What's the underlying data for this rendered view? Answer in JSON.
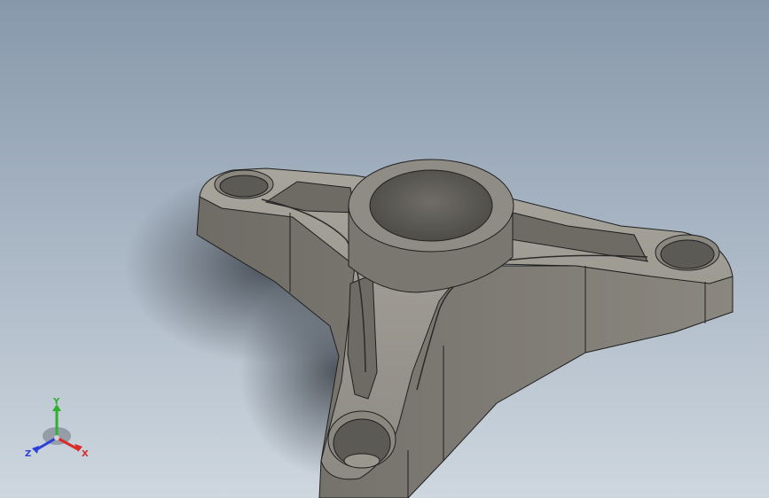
{
  "triad": {
    "x_label": "X",
    "y_label": "Y",
    "z_label": "Z",
    "x_color": "#d92b2b",
    "y_color": "#2fb02f",
    "z_color": "#2b3fd9"
  },
  "colors": {
    "background_top": "#8798ab",
    "background_bottom": "#ced7df",
    "part_face": "#7f7c75",
    "part_top": "#9b9890",
    "part_shade": "#605d57",
    "edge": "#1f1f1f"
  },
  "icons": {
    "part": "3d-part-icon",
    "triad": "axis-triad-icon"
  }
}
